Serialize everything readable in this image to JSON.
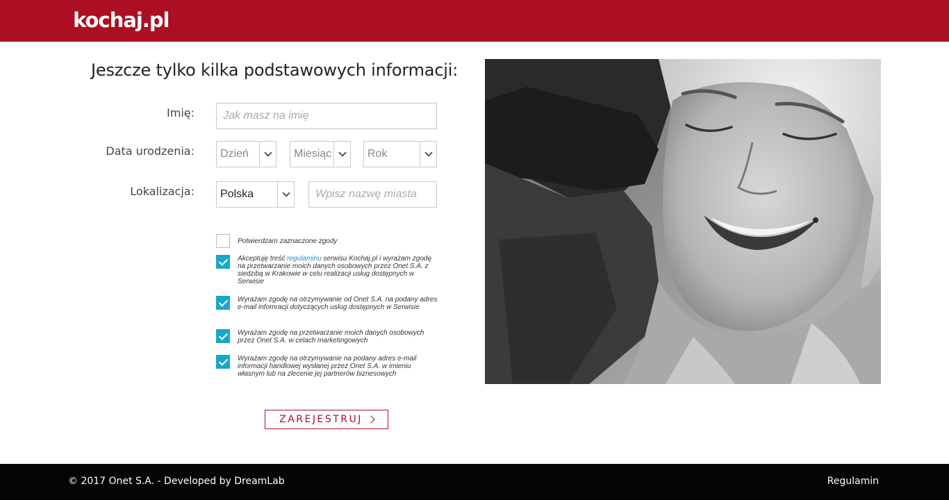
{
  "header": {
    "logo": "kochaj.pl"
  },
  "form": {
    "title": "Jeszcze tylko kilka podstawowych informacji:",
    "name_label": "Imię:",
    "name_placeholder": "Jak masz na imię",
    "birth_label": "Data urodzenia:",
    "day": "Dzień",
    "month": "Miesiąc",
    "year": "Rok",
    "location_label": "Lokalizacja:",
    "country": "Polska",
    "city_placeholder": "Wpisz nazwę miasta",
    "consents": [
      {
        "text": "Potwierdzam zaznaczone zgody",
        "checked": false
      },
      {
        "text_before": "Akceptuję treść ",
        "link": "regulaminu",
        "text_after": " serwisu Kochaj.pl i wyrażam zgodę na przetwarzanie moich danych osobowych przez Onet S.A. z siedzibą w Krakowie w celu realizacji usług dostępnych w Serwisie",
        "checked": true
      },
      {
        "text": "Wyrażam zgodę na otrzymywanie od Onet S.A. na podany adres e-mail infomracji dotyczących usług dostępnych w Serwisie",
        "checked": true
      },
      {
        "text": "Wyrażam zgodę na przetwarzanie moich danych osobowych przez Onet S.A. w celach marketingowych",
        "checked": true
      },
      {
        "text": "Wyrażam zgodę na otrzymywanie na podany adres e-mail informacji handlowej wysłanej przez Onet S.A. w imieniu własnym lub na zlecenie jej partnerów biznesowych",
        "checked": true
      }
    ],
    "submit": "ZAREJESTRUJ"
  },
  "footer": {
    "copyright": "© 2017 Onet S.A. - Developed by DreamLab",
    "terms": "Regulamin"
  },
  "colors": {
    "brand": "#ad0f22",
    "checkbox": "#18a7c9",
    "footer": "#050505"
  }
}
